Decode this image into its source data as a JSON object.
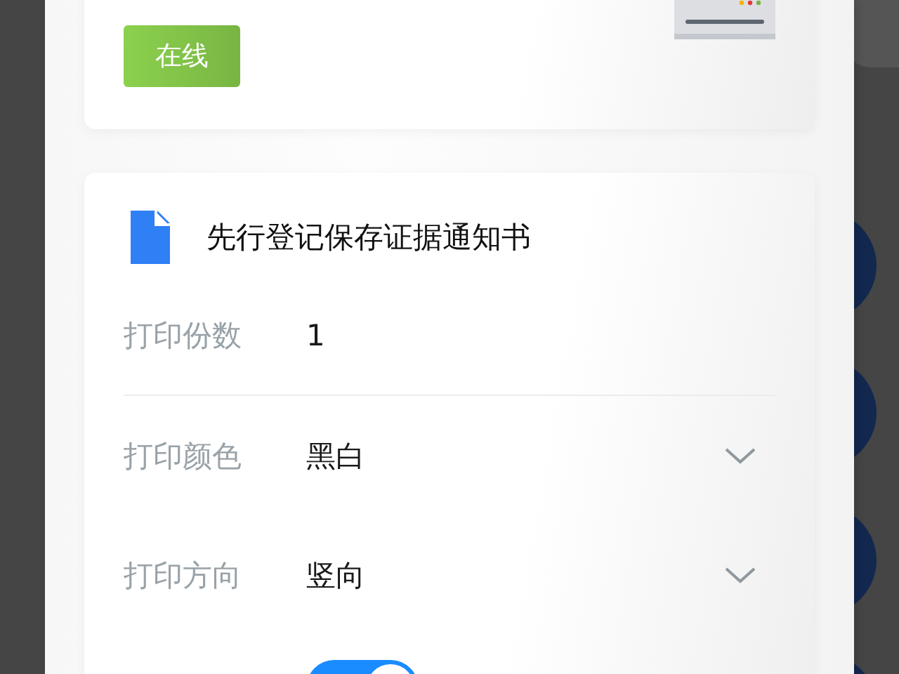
{
  "device_card": {
    "status": {
      "label": "在线",
      "online": true
    }
  },
  "print_card": {
    "title": "先行登记保存证据通知书",
    "fields": [
      {
        "kind": "number",
        "label": "打印份数",
        "value": "1"
      },
      {
        "kind": "select",
        "label": "打印颜色",
        "value": "黑白"
      },
      {
        "kind": "select",
        "label": "打印方向",
        "value": "竖向"
      },
      {
        "kind": "toggle",
        "on": true
      }
    ]
  }
}
